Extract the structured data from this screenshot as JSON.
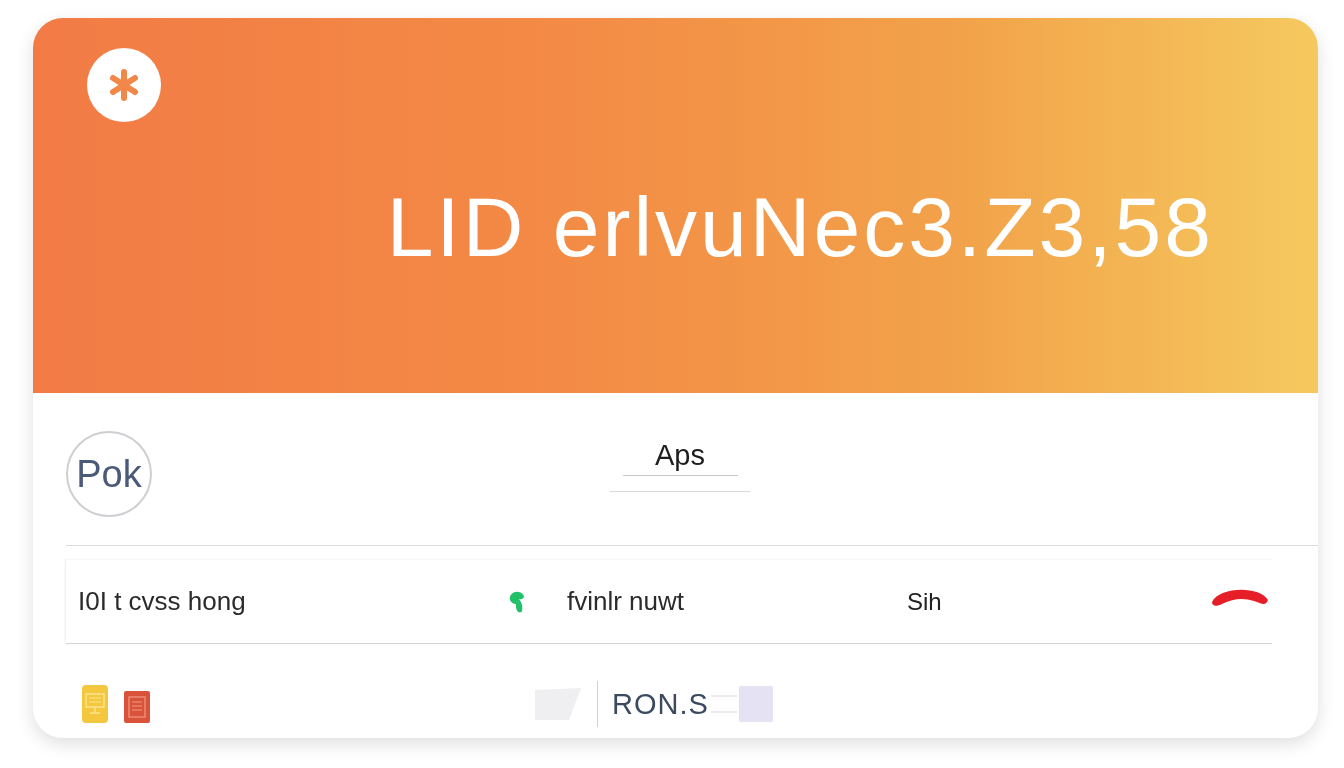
{
  "header": {
    "title": "LID erlvuNec3.Z3,58"
  },
  "profile": {
    "avatar_text": "Pok",
    "heading": "Aps"
  },
  "list_row": {
    "cells": [
      "I0I t cvss hong",
      "fvinlr nuwt",
      "Sih"
    ]
  },
  "footer": {
    "label": "RON.S"
  }
}
